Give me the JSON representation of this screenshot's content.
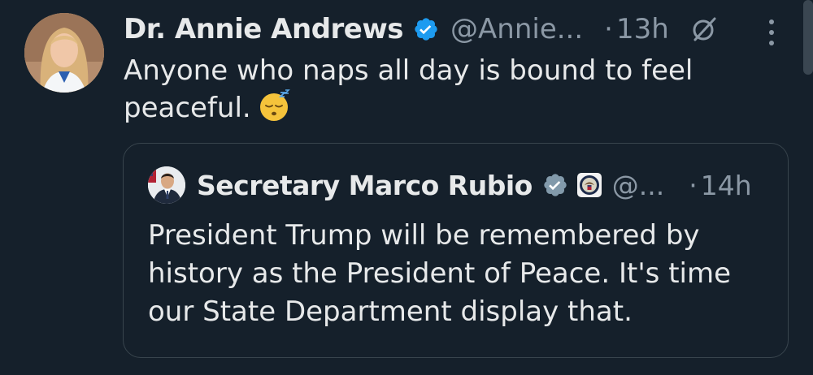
{
  "tweet": {
    "author_name": "Dr. Annie Andrews",
    "author_handle": "@Annie...",
    "separator": "·",
    "time": "13h",
    "text": "Anyone who naps all day is bound to feel peaceful.",
    "emoji": "sleeping-face",
    "verified_color": "#1d9bf0"
  },
  "quoted_tweet": {
    "author_name": "Secretary Marco Rubio",
    "author_handle": "@...",
    "separator": "·",
    "time": "14h",
    "text": "President Trump will be remembered by history as the President of Peace. It's time our State Department display that.",
    "verified_color": "#829aab",
    "affiliation_icon": "state-department-seal"
  },
  "icons": {
    "grok": "grok-icon",
    "more": "more-options-icon"
  }
}
